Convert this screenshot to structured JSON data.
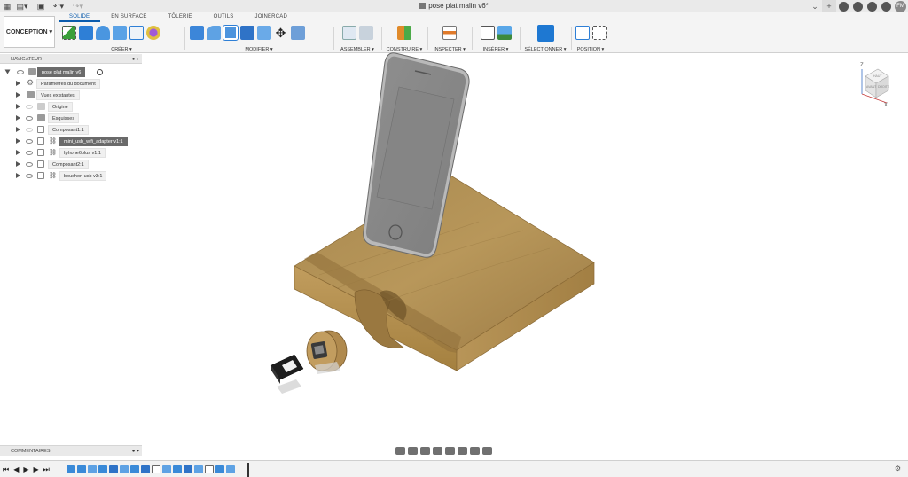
{
  "window": {
    "document_title": "pose plat malin v6*",
    "user_initials": "FM"
  },
  "workspace": {
    "label": "CONCEPTION ▾"
  },
  "tabs": [
    {
      "label": "SOLIDE",
      "active": true
    },
    {
      "label": "EN SURFACE"
    },
    {
      "label": "TÔLERIE"
    },
    {
      "label": "OUTILS"
    },
    {
      "label": "JOINERCAD"
    }
  ],
  "ribbon_groups": {
    "create": "CRÉER ▾",
    "modify": "MODIFIER ▾",
    "assemble": "ASSEMBLER ▾",
    "construct": "CONSTRUIRE ▾",
    "inspect": "INSPECTER ▾",
    "insert": "INSÉRER ▾",
    "select": "SÉLECTIONNER ▾",
    "position": "POSITION ▾"
  },
  "navigator": {
    "title": "NAVIGATEUR",
    "items": [
      {
        "label": "pose plat malin v6",
        "selected": true
      },
      {
        "label": "Paramètres du document"
      },
      {
        "label": "Vues existantes"
      },
      {
        "label": "Origine"
      },
      {
        "label": "Esquisses"
      },
      {
        "label": "Composant1:1"
      },
      {
        "label": "mini_usb_wifi_adapter v1:1",
        "selected": true
      },
      {
        "label": "Iphone6plus v1:1"
      },
      {
        "label": "Composant2:1"
      },
      {
        "label": "bouchon usb v3:1"
      }
    ]
  },
  "comments": {
    "title": "COMMENTAIRES"
  },
  "viewcube": {
    "top": "HAUT",
    "front": "AVANT",
    "right": "DROITE"
  },
  "colors": {
    "accent": "#0b5cad",
    "wood": "#b08a4e",
    "phone": "#8c8c8c"
  }
}
